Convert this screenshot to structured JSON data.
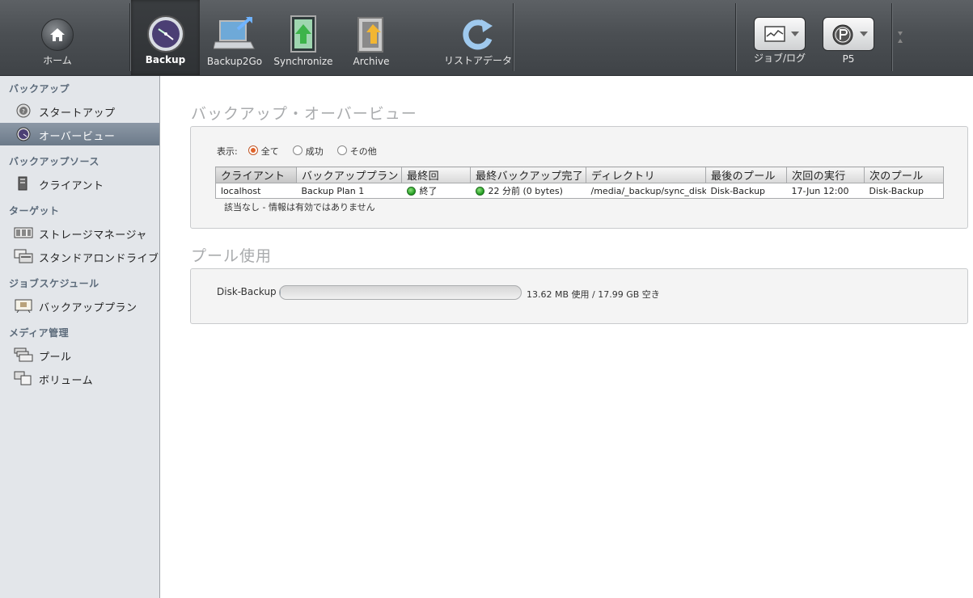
{
  "toolbar": {
    "home_label": "ホーム",
    "backup_label": "Backup",
    "backup2go_label": "Backup2Go",
    "synchronize_label": "Synchronize",
    "archive_label": "Archive",
    "restore_label": "リストアデータ",
    "joblog_label": "ジョブ/ログ",
    "p5_label": "P5"
  },
  "sidebar": {
    "sections": [
      {
        "heading": "バックアップ",
        "items": [
          {
            "label": "スタートアップ",
            "icon": "startup-icon"
          },
          {
            "label": "オーバービュー",
            "icon": "overview-icon",
            "selected": true
          }
        ]
      },
      {
        "heading": "バックアップソース",
        "items": [
          {
            "label": "クライアント",
            "icon": "client-icon"
          }
        ]
      },
      {
        "heading": "ターゲット",
        "items": [
          {
            "label": "ストレージマネージャ",
            "icon": "storage-manager-icon"
          },
          {
            "label": "スタンドアロンドライブ",
            "icon": "standalone-drive-icon"
          }
        ]
      },
      {
        "heading": "ジョブスケジュール",
        "items": [
          {
            "label": "バックアッププラン",
            "icon": "backup-plan-icon"
          }
        ]
      },
      {
        "heading": "メディア管理",
        "items": [
          {
            "label": "プール",
            "icon": "pool-icon"
          },
          {
            "label": "ボリューム",
            "icon": "volume-icon"
          }
        ]
      }
    ]
  },
  "overview": {
    "title": "バックアップ・オーバービュー",
    "filter": {
      "label": "表示:",
      "options": [
        "全て",
        "成功",
        "その他"
      ],
      "selected": "全て"
    },
    "columns": [
      "クライアント",
      "バックアッププラン",
      "最終回",
      "最終バックアップ完了",
      "ディレクトリ",
      "最後のプール",
      "次回の実行",
      "次のプール"
    ],
    "rows": [
      {
        "client": "localhost",
        "plan": "Backup Plan 1",
        "last_run": "終了",
        "last_completed": "22 分前 (0 bytes)",
        "directory": "/media/_backup/sync_disk",
        "last_pool": "Disk-Backup",
        "next_run": "17-Jun 12:00",
        "next_pool": "Disk-Backup"
      }
    ],
    "note": "該当なし - 情報は有効ではありません"
  },
  "pool_usage": {
    "title": "プール使用",
    "pools": [
      {
        "name": "Disk-Backup",
        "usage_text": "13.62 MB 使用 / 17.99 GB 空き",
        "fraction_used": 0.001
      }
    ]
  },
  "colors": {
    "toolbar_bg": "#4b4f53",
    "sidebar_bg": "#e3e6ea",
    "selected_item": "#7a8795",
    "status_ok": "#1e9a1e",
    "radio_on": "#e0632a"
  }
}
